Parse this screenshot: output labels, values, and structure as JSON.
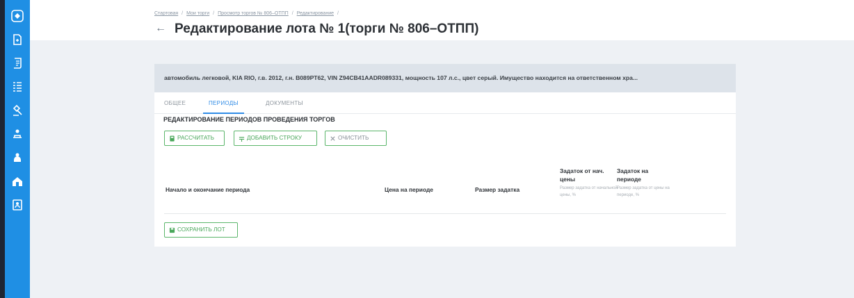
{
  "sidebar": {
    "items": [
      {
        "icon": "logo-icon"
      },
      {
        "icon": "document-icon"
      },
      {
        "icon": "scroll-icon"
      },
      {
        "icon": "list-icon"
      },
      {
        "icon": "gavel-icon"
      },
      {
        "icon": "person-icon"
      },
      {
        "icon": "person-group-icon"
      },
      {
        "icon": "home-icon"
      },
      {
        "icon": "contact-card-icon"
      }
    ],
    "color": "#1f8fe4"
  },
  "breadcrumb": {
    "items": [
      "Стартовая",
      "Мои торги",
      "Просмотр торгов № 806–ОТПП",
      "Редактирование"
    ],
    "separator": "/"
  },
  "header": {
    "back_icon": "arrow-left-icon",
    "title": "Редактирование лота № 1(торги № 806–ОТПП)"
  },
  "lot": {
    "description": "автомобиль легковой, KIA RIO, г.в. 2012, г.н. В089РТ62, VIN Z94CB41AADR089331, мощность 107 л.с., цвет серый. Имущество находится на ответственном хра..."
  },
  "tabs": [
    {
      "label": "ОБЩЕЕ",
      "active": false
    },
    {
      "label": "ПЕРИОДЫ",
      "active": true
    },
    {
      "label": "ДОКУМЕНТЫ",
      "active": false
    }
  ],
  "section": {
    "title": "РЕДАКТИРОВАНИЕ ПЕРИОДОВ ПРОВЕДЕНИЯ ТОРГОВ"
  },
  "toolbar": {
    "calc_label": "РАССЧИТАТЬ",
    "add_row_label": "ДОБАВИТЬ СТРОКУ",
    "clear_label": "ОЧИСТИТЬ"
  },
  "table": {
    "columns": [
      {
        "label": "Начало и окончание периода"
      },
      {
        "label": "Цена на периоде"
      },
      {
        "label": "Размер задатка"
      },
      {
        "label": "Задаток от нач. цены",
        "sub": "Размер задатка от начальной цены, %"
      },
      {
        "label": "Задаток на периоде",
        "sub": "Размер задатка от цены на периоде, %"
      }
    ]
  },
  "footer": {
    "save_label": "СОХРАНИТЬ ЛОТ"
  },
  "colors": {
    "accent": "#2f8be6",
    "button_green": "#4aa75b",
    "banner_bg": "#dde3ea",
    "page_bg": "#eef1f5"
  }
}
